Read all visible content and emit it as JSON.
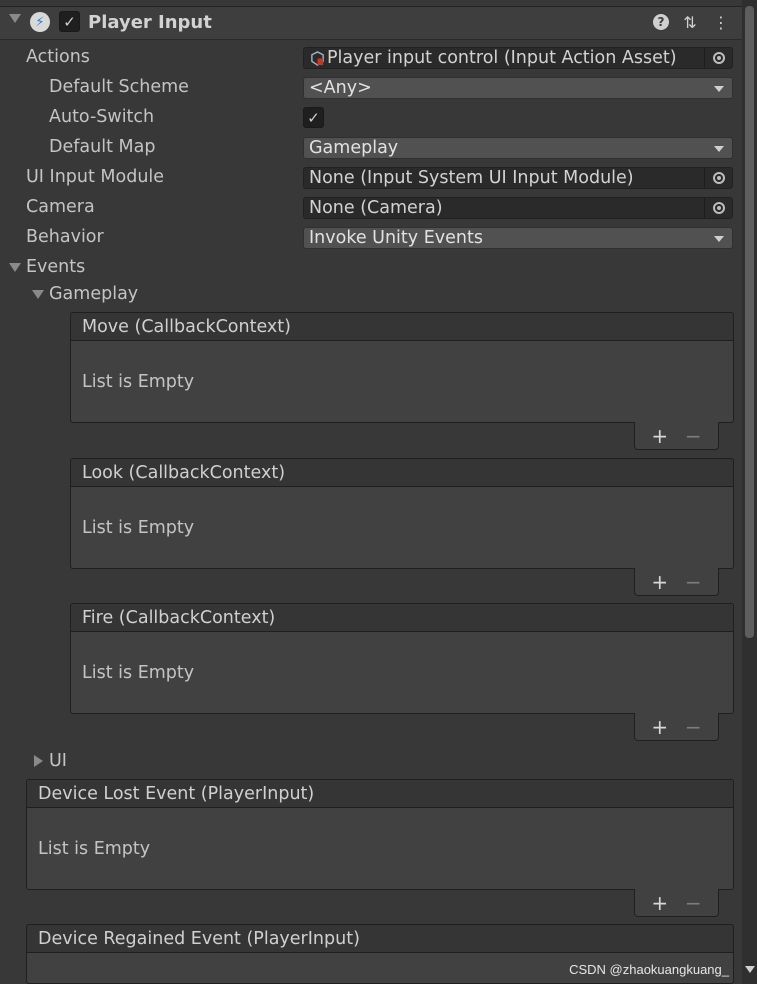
{
  "component": {
    "title": "Player Input",
    "enabled": true,
    "icons": {
      "component": "input-action-icon",
      "help": "help-icon",
      "presets": "presets-icon",
      "menu": "kebab-menu-icon"
    }
  },
  "properties": {
    "actions": {
      "label": "Actions",
      "value": "Player input control (Input Action Asset)"
    },
    "default_scheme": {
      "label": "Default Scheme",
      "value": "<Any>"
    },
    "auto_switch": {
      "label": "Auto-Switch",
      "checked": true
    },
    "default_map": {
      "label": "Default Map",
      "value": "Gameplay"
    },
    "ui_input_module": {
      "label": "UI Input Module",
      "value": "None (Input System UI Input Module)"
    },
    "camera": {
      "label": "Camera",
      "value": "None (Camera)"
    },
    "behavior": {
      "label": "Behavior",
      "value": "Invoke Unity Events"
    }
  },
  "events": {
    "label": "Events",
    "gameplay": {
      "label": "Gameplay",
      "lists": [
        {
          "title": "Move (CallbackContext)",
          "empty_text": "List is Empty"
        },
        {
          "title": "Look (CallbackContext)",
          "empty_text": "List is Empty"
        },
        {
          "title": "Fire (CallbackContext)",
          "empty_text": "List is Empty"
        }
      ]
    },
    "ui": {
      "label": "UI"
    },
    "device_lost": {
      "title": "Device Lost Event (PlayerInput)",
      "empty_text": "List is Empty"
    },
    "device_regained": {
      "title": "Device Regained Event (PlayerInput)"
    }
  },
  "list_controls": {
    "add": "+",
    "remove": "−"
  },
  "watermark": "CSDN @zhaokuangkuang_",
  "colors": {
    "background": "#383838",
    "field": "#2a2a2a",
    "dropdown": "#515151",
    "accent_icon": "#2b7bd0"
  }
}
